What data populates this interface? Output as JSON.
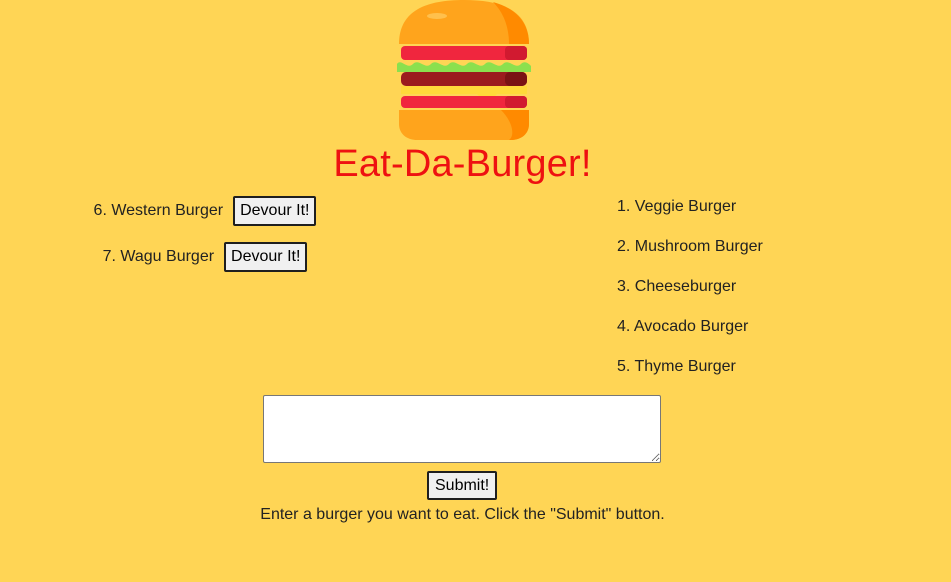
{
  "app": {
    "title": "Eat-Da-Burger!"
  },
  "logo": {
    "icon": "burger-icon"
  },
  "uneaten": {
    "items": [
      {
        "label": "6. Western Burger",
        "button_label": "Devour It!"
      },
      {
        "label": "7. Wagu Burger",
        "button_label": "Devour It!"
      }
    ]
  },
  "eaten": {
    "items": [
      {
        "label": "1. Veggie Burger"
      },
      {
        "label": "2. Mushroom Burger"
      },
      {
        "label": "3. Cheeseburger"
      },
      {
        "label": "4. Avocado Burger"
      },
      {
        "label": "5. Thyme Burger"
      }
    ]
  },
  "form": {
    "textarea_value": "",
    "submit_label": "Submit!",
    "instructions": "Enter a burger you want to eat. Click the \"Submit\" button."
  },
  "colors": {
    "background": "#FFD555",
    "title": "#EE1111"
  }
}
